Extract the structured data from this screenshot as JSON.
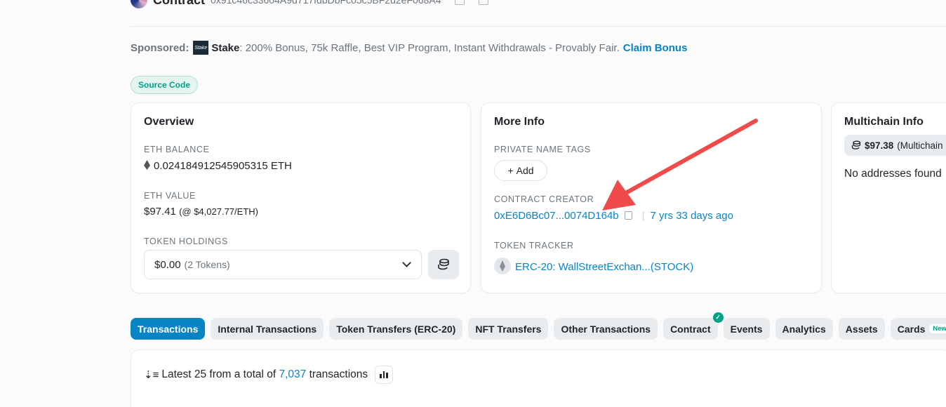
{
  "header": {
    "title": "Contract",
    "address": "0x91c46c33604A9d717fdbDbFc05c5BF2d2eF068A4"
  },
  "sponsored": {
    "label": "Sponsored:",
    "logo_text": "Stake",
    "brand": "Stake",
    "text": ": 200% Bonus, 75k Raffle, Best VIP Program, Instant Withdrawals - Provably Fair.",
    "cta": "Claim Bonus"
  },
  "source_code_badge": "Source Code",
  "overview": {
    "title": "Overview",
    "eth_balance_label": "ETH BALANCE",
    "eth_balance": "0.024184912545905315 ETH",
    "eth_value_label": "ETH VALUE",
    "eth_value": "$97.41",
    "eth_price": "(@ $4,027.77/ETH)",
    "token_holdings_label": "TOKEN HOLDINGS",
    "token_holdings_value": "$0.00",
    "token_holdings_count": "(2 Tokens)"
  },
  "more_info": {
    "title": "More Info",
    "private_tags_label": "PRIVATE NAME TAGS",
    "add_label": "Add",
    "creator_label": "CONTRACT CREATOR",
    "creator_address": "0xE6D6Bc07...0074D164b",
    "creator_age": "7 yrs 33 days ago",
    "tracker_label": "TOKEN TRACKER",
    "tracker_value": "ERC-20: WallStreetExchan...(STOCK)"
  },
  "multichain": {
    "title": "Multichain Info",
    "pill_value": "$97.38",
    "pill_text": "(Multichain",
    "empty_text": "No addresses found"
  },
  "tabs": [
    {
      "label": "Transactions",
      "active": true
    },
    {
      "label": "Internal Transactions"
    },
    {
      "label": "Token Transfers (ERC-20)"
    },
    {
      "label": "NFT Transfers"
    },
    {
      "label": "Other Transactions"
    },
    {
      "label": "Contract",
      "verified": true
    },
    {
      "label": "Events"
    },
    {
      "label": "Analytics"
    },
    {
      "label": "Assets"
    },
    {
      "label": "Cards",
      "badge": "New"
    }
  ],
  "transactions": {
    "prefix": "Latest 25 from a total of",
    "count": "7,037",
    "suffix": "transactions"
  },
  "colors": {
    "link": "#0784c3",
    "success": "#00a186",
    "annotation_arrow": "#f04a4a"
  }
}
